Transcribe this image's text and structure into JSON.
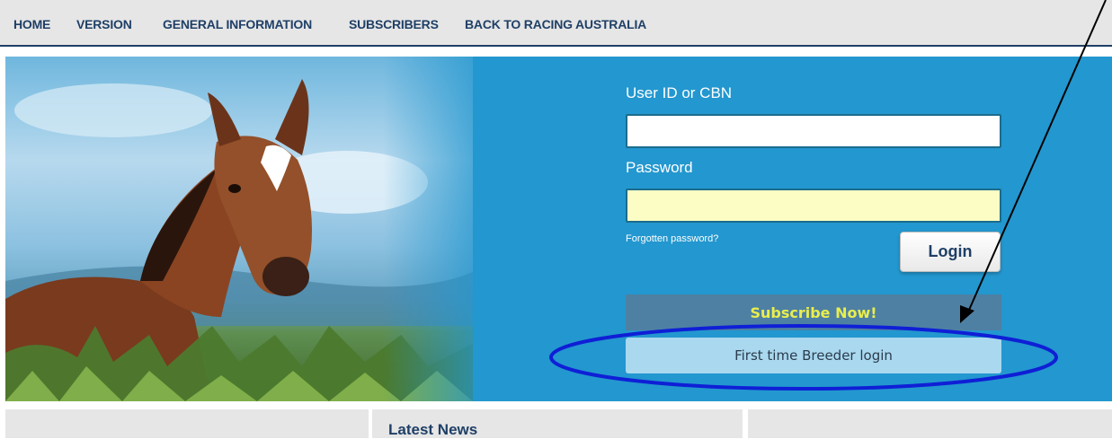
{
  "nav": {
    "items": [
      {
        "label": "HOME"
      },
      {
        "label": "VERSION"
      },
      {
        "label": "GENERAL INFORMATION"
      },
      {
        "label": "SUBSCRIBERS"
      },
      {
        "label": "BACK TO RACING AUSTRALIA"
      }
    ]
  },
  "login": {
    "user_label": "User ID or CBN",
    "user_value": "",
    "password_label": "Password",
    "password_value": "",
    "forgot_link": "Forgotten password?",
    "login_button": "Login",
    "subscribe_button": "Subscribe Now!",
    "first_time_button": "First time Breeder login"
  },
  "news": {
    "title": "Latest News"
  },
  "colors": {
    "nav_text": "#1f3f66",
    "hero_blue": "#2397cf",
    "password_fill": "#fbfdc4",
    "subscribe_bg": "#4e80a3",
    "subscribe_text": "#e9ee4c",
    "first_time_bg": "#a9d8ef",
    "annotation_ellipse": "#0f1fd6"
  },
  "hero_image": {
    "icon": "foal-in-grass-photo"
  }
}
